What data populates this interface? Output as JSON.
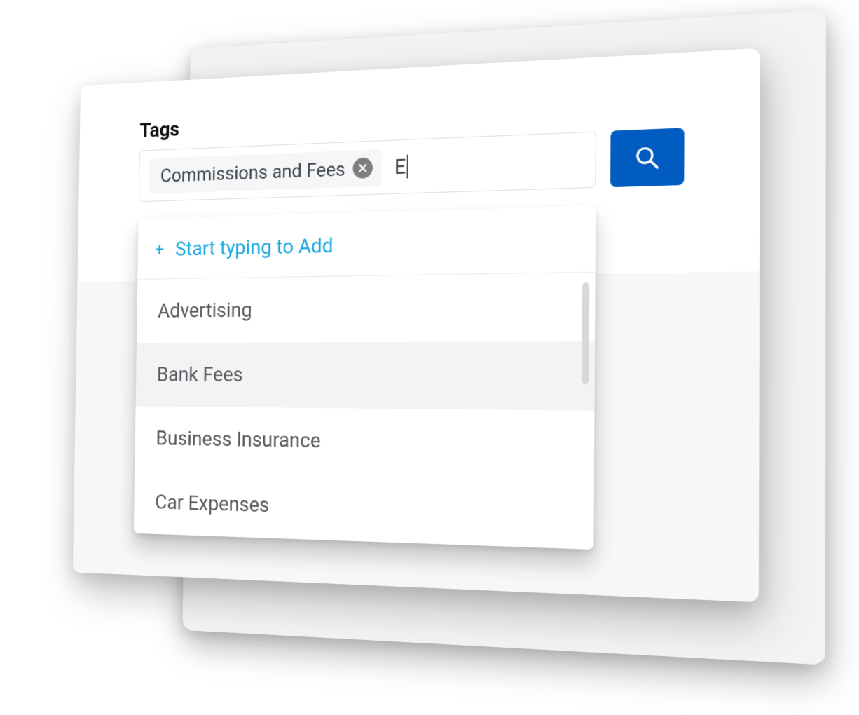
{
  "label": "Tags",
  "chip": {
    "text": "Commissions and Fees"
  },
  "typed_value": "E",
  "add_prompt": "Start typing to Add",
  "options": [
    "Advertising",
    "Bank Fees",
    "Business Insurance",
    "Car Expenses"
  ],
  "highlight_index": 1,
  "colors": {
    "accent_blue": "#005cc1",
    "link_cyan": "#1aa7e0"
  }
}
